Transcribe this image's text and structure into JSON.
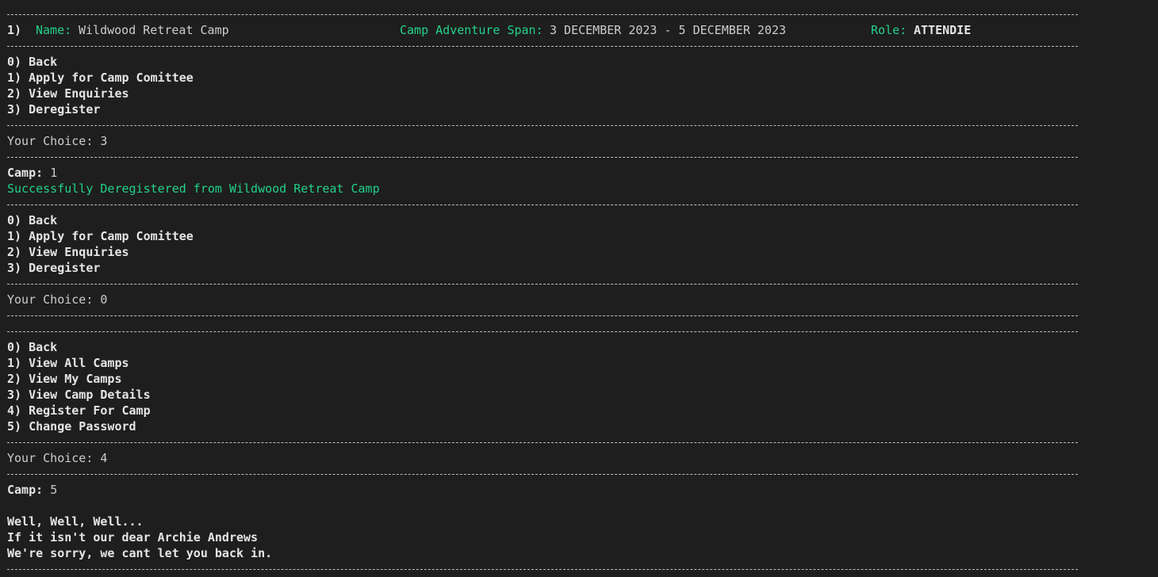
{
  "colors": {
    "background": "#1e1e1e",
    "text": "#cccccc",
    "accent_green": "#23d18b",
    "separator": "#bdbdbd"
  },
  "header": {
    "index": "1)",
    "name_label": "Name:",
    "name_value": "Wildwood Retreat Camp",
    "span_label": "Camp Adventure Span:",
    "span_value": "3 DECEMBER 2023 - 5 DECEMBER 2023",
    "role_label": "Role:",
    "role_value": "ATTENDIE"
  },
  "camp_menu_1": [
    "0) Back",
    "1) Apply for Camp Comittee",
    "2) View Enquiries",
    "3) Deregister"
  ],
  "choice_1": {
    "label": "Your Choice:",
    "value": "3"
  },
  "camp_prompt_1": {
    "label": "Camp:",
    "value": "1"
  },
  "success_message": "Successfully Deregistered from Wildwood Retreat Camp",
  "camp_menu_2": [
    "0) Back",
    "1) Apply for Camp Comittee",
    "2) View Enquiries",
    "3) Deregister"
  ],
  "choice_2": {
    "label": "Your Choice:",
    "value": "0"
  },
  "main_menu": [
    "0) Back",
    "1) View All Camps",
    "2) View My Camps",
    "3) View Camp Details",
    "4) Register For Camp",
    "5) Change Password"
  ],
  "choice_3": {
    "label": "Your Choice:",
    "value": "4"
  },
  "camp_prompt_2": {
    "label": "Camp:",
    "value": "5"
  },
  "rejection_message": [
    "Well, Well, Well...",
    "If it isn't our dear Archie Andrews",
    "We're sorry, we cant let you back in."
  ]
}
